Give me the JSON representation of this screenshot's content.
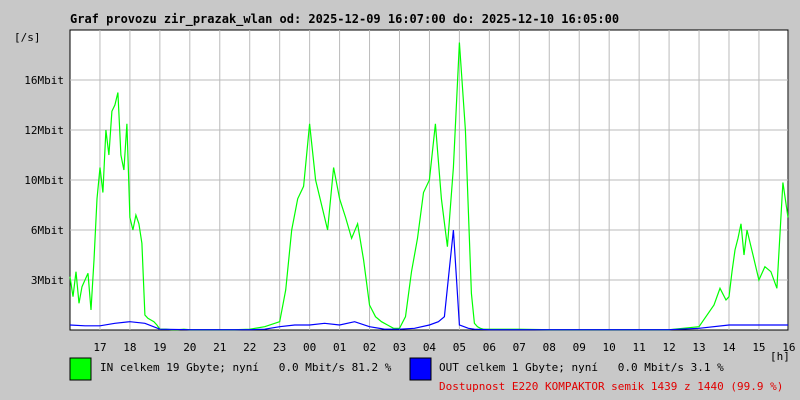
{
  "chart_data": {
    "type": "line",
    "title": "Graf provozu zir_prazak_wlan od: 2025-12-09 16:07:00 do: 2025-12-10 16:05:00",
    "ylabel": "[/s]",
    "xlabel": "[h]",
    "y_ticks": [
      {
        "value": 3,
        "label": "3Mbit"
      },
      {
        "value": 6,
        "label": "6Mbit"
      },
      {
        "value": 10,
        "label": "10Mbit"
      },
      {
        "value": 12,
        "label": "12Mbit"
      },
      {
        "value": 16,
        "label": "16Mbit"
      }
    ],
    "x_tick_labels": [
      "17",
      "18",
      "19",
      "20",
      "21",
      "22",
      "23",
      "00",
      "01",
      "02",
      "03",
      "04",
      "05",
      "06",
      "07",
      "08",
      "09",
      "10",
      "11",
      "12",
      "13",
      "14",
      "15",
      "16"
    ],
    "x_range_hours": [
      0,
      23.97
    ],
    "grid": true,
    "series": [
      {
        "name": "IN",
        "color": "#00ff00",
        "x_hours": [
          0.0,
          0.1,
          0.2,
          0.3,
          0.4,
          0.5,
          0.6,
          0.7,
          0.8,
          0.9,
          1.0,
          1.1,
          1.2,
          1.3,
          1.4,
          1.5,
          1.6,
          1.7,
          1.8,
          1.9,
          2.0,
          2.1,
          2.2,
          2.3,
          2.4,
          2.5,
          2.6,
          2.7,
          2.8,
          2.9,
          3.0,
          3.2,
          3.4,
          3.6,
          3.8,
          4.0,
          4.5,
          5.0,
          5.5,
          6.0,
          6.5,
          7.0,
          7.2,
          7.4,
          7.6,
          7.8,
          8.0,
          8.2,
          8.4,
          8.6,
          8.8,
          9.0,
          9.2,
          9.4,
          9.6,
          9.8,
          10.0,
          10.2,
          10.4,
          10.6,
          10.8,
          11.0,
          11.2,
          11.4,
          11.6,
          11.8,
          12.0,
          12.2,
          12.4,
          12.6,
          12.8,
          13.0,
          13.2,
          13.4,
          13.5,
          13.6,
          13.7,
          13.8,
          13.9,
          14.0,
          14.5,
          15.0,
          16.0,
          17.0,
          18.0,
          19.0,
          20.0,
          21.0,
          21.5,
          21.7,
          21.9,
          22.0,
          22.1,
          22.2,
          22.3,
          22.4,
          22.5,
          22.6,
          22.8,
          23.0,
          23.2,
          23.4,
          23.6,
          23.8,
          23.97
        ],
        "values": [
          3.2,
          2.0,
          3.5,
          1.6,
          2.6,
          3.0,
          3.4,
          1.2,
          4.2,
          8.5,
          10.5,
          9.0,
          12.0,
          11.0,
          13.5,
          14.0,
          15.0,
          11.0,
          10.4,
          12.5,
          7.0,
          6.0,
          7.2,
          6.5,
          5.2,
          0.9,
          0.7,
          0.6,
          0.5,
          0.3,
          0.05,
          0.05,
          0.02,
          0.02,
          0.05,
          0.02,
          0.02,
          0.02,
          0.02,
          0.05,
          0.2,
          0.5,
          2.4,
          6.0,
          8.5,
          9.5,
          12.5,
          10.0,
          8.0,
          6.0,
          10.5,
          8.5,
          7.0,
          5.5,
          6.5,
          4.2,
          1.5,
          0.8,
          0.5,
          0.3,
          0.1,
          0.1,
          0.8,
          3.5,
          5.5,
          9.0,
          10.0,
          12.5,
          8.5,
          5.0,
          10.5,
          17.5,
          12.0,
          2.2,
          0.4,
          0.2,
          0.1,
          0.05,
          0.05,
          0.05,
          0.05,
          0.05,
          0.02,
          0.02,
          0.02,
          0.02,
          0.02,
          0.2,
          1.5,
          2.5,
          1.8,
          2.0,
          3.5,
          4.8,
          5.5,
          6.5,
          4.5,
          6.0,
          4.5,
          3.0,
          3.8,
          3.5,
          2.5,
          9.8,
          7.0
        ]
      },
      {
        "name": "OUT",
        "color": "#0000ff",
        "x_hours": [
          0.0,
          0.5,
          1.0,
          1.5,
          2.0,
          2.5,
          3.0,
          4.0,
          5.0,
          6.0,
          6.5,
          7.0,
          7.5,
          8.0,
          8.5,
          9.0,
          9.5,
          10.0,
          10.5,
          11.0,
          11.5,
          12.0,
          12.3,
          12.5,
          12.8,
          13.0,
          13.3,
          13.5,
          14.0,
          15.0,
          16.0,
          17.0,
          18.0,
          19.0,
          20.0,
          21.0,
          22.0,
          23.0,
          23.97
        ],
        "values": [
          0.3,
          0.25,
          0.25,
          0.4,
          0.5,
          0.4,
          0.05,
          0.02,
          0.02,
          0.02,
          0.05,
          0.2,
          0.3,
          0.3,
          0.4,
          0.3,
          0.5,
          0.2,
          0.05,
          0.05,
          0.1,
          0.3,
          0.5,
          0.8,
          6.0,
          0.3,
          0.1,
          0.05,
          0.02,
          0.02,
          0.02,
          0.02,
          0.02,
          0.02,
          0.02,
          0.1,
          0.3,
          0.3,
          0.3
        ]
      }
    ]
  },
  "legend": {
    "in_text": "IN celkem 19 Gbyte; nyní   0.0 Mbit/s 81.2 %",
    "out_text": "OUT celkem 1 Gbyte; nyní   0.0 Mbit/s 3.1 %",
    "availability_text": "Dostupnost E220 KOMPAKTOR semik 1439 z 1440 (99.9 %)",
    "availability_color": "#e00000"
  }
}
